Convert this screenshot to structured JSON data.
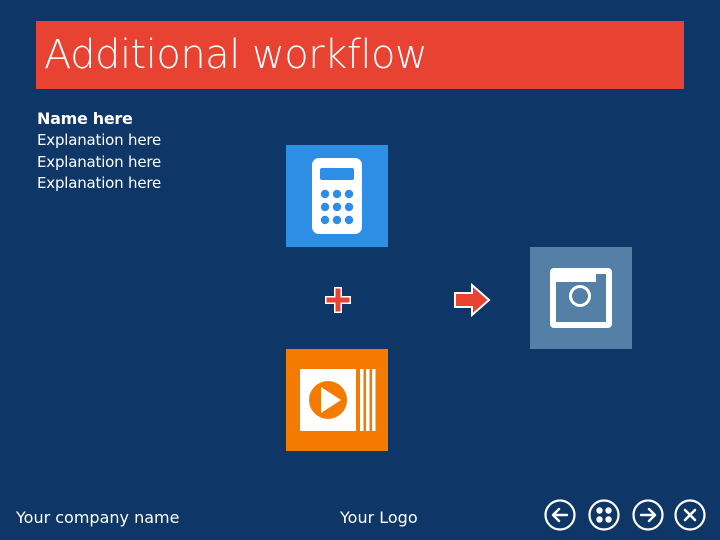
{
  "slide": {
    "title": "Additional workflow",
    "name": "Name here",
    "explanations": [
      "Explanation here",
      "Explanation here",
      "Explanation here"
    ]
  },
  "workflow": {
    "inputs": [
      "calculator-icon",
      "video-player-icon"
    ],
    "operator": "plus-icon",
    "connector": "arrow-right-icon",
    "output": "camera-icon",
    "colors": {
      "background": "#0e3666",
      "title_bar": "#e84233",
      "calculator_tile": "#2d8ee6",
      "video_tile": "#f47a00",
      "camera_tile": "#547fa6",
      "operator": "#e84233"
    }
  },
  "footer": {
    "company": "Your company name",
    "logo": "Your Logo"
  },
  "navigation": {
    "buttons": [
      "back-arrow-icon",
      "menu-dots-icon",
      "forward-arrow-icon",
      "close-icon"
    ]
  }
}
